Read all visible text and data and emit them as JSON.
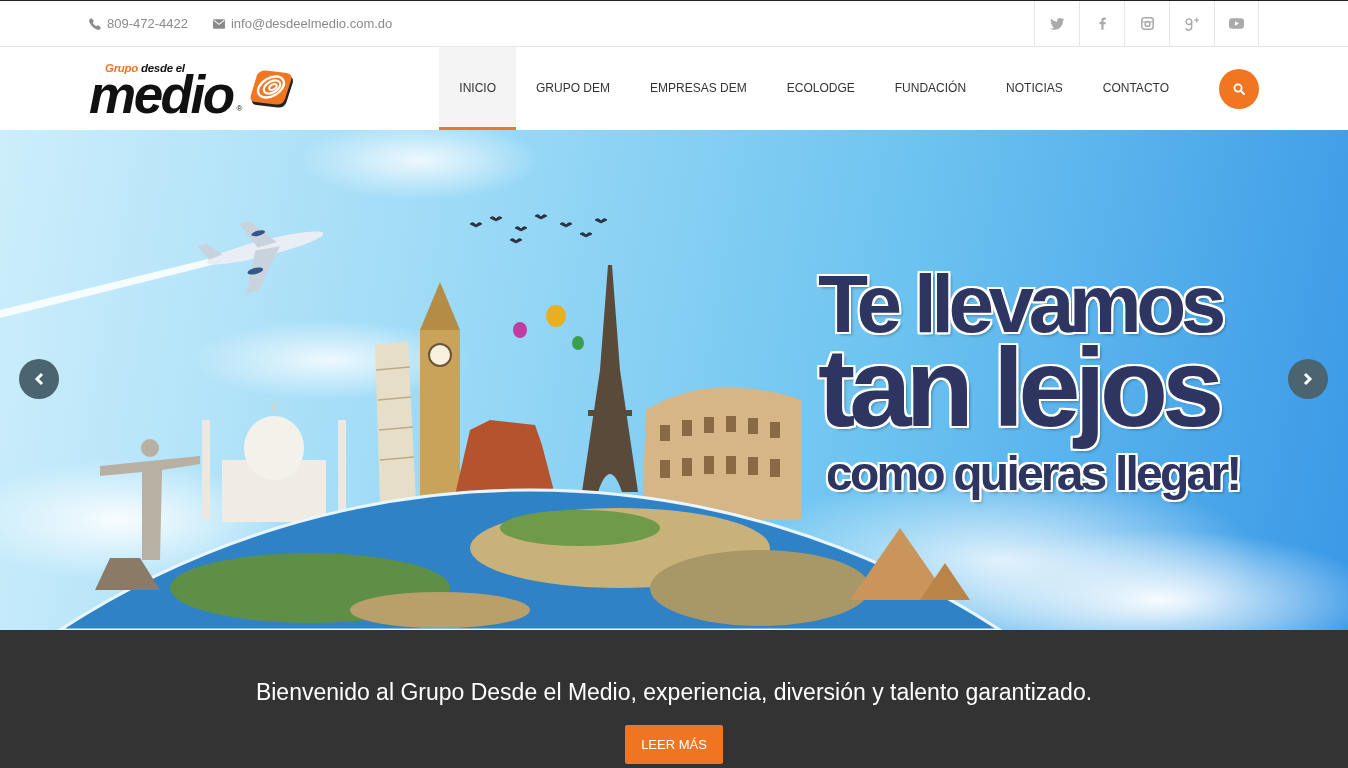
{
  "top_bar": {
    "phone": "809-472-4422",
    "email": "info@desdeelmedio.com.do",
    "social_links": [
      {
        "kind": "twitter"
      },
      {
        "kind": "facebook"
      },
      {
        "kind": "instagram"
      },
      {
        "kind": "google_plus"
      },
      {
        "kind": "youtube"
      }
    ]
  },
  "header": {
    "logo": {
      "prefix": "Grupo",
      "middle": "desde el",
      "name": "medio",
      "mark": "®"
    },
    "nav": [
      {
        "label": "INICIO",
        "selected": true
      },
      {
        "label": "GRUPO DEM",
        "selected": false
      },
      {
        "label": "EMPRESAS DEM",
        "selected": false
      },
      {
        "label": "ECOLODGE",
        "selected": false
      },
      {
        "label": "FUNDACIÓN",
        "selected": false
      },
      {
        "label": "NOTICIAS",
        "selected": false
      },
      {
        "label": "CONTACTO",
        "selected": false
      }
    ]
  },
  "slider": {
    "headline": [
      "Te llevamos",
      "tan lejos",
      "como quieras llegar!"
    ]
  },
  "welcome": {
    "message": "Bienvenido al Grupo Desde el Medio, experiencia, diversión y talento garantizado.",
    "button": "LEER MÁS"
  }
}
